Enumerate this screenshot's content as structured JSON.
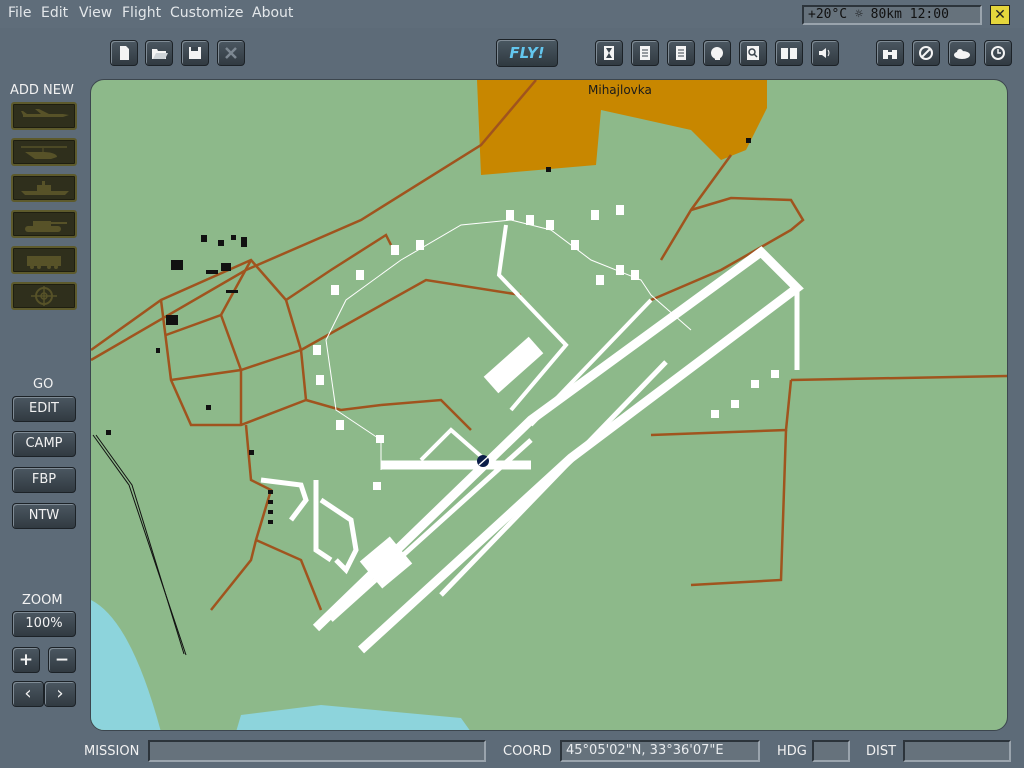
{
  "menu": [
    "File",
    "Edit",
    "View",
    "Flight",
    "Customize",
    "About"
  ],
  "weather": {
    "temperature": "+20°C",
    "visibility": "80km",
    "time": "12:00",
    "icon": "sun-icon"
  },
  "toolbar": {
    "left_icons": [
      "new-file-icon",
      "open-folder-icon",
      "save-icon",
      "close-file-icon"
    ],
    "fly_label": "FLY!",
    "center_icons": [
      "hourglass-icon",
      "clipboard-icon",
      "checklist-icon",
      "pilot-head-icon",
      "magnifier-icon",
      "book-icon",
      "speaker-icon"
    ],
    "right_icons": [
      "binoculars-icon",
      "forbidden-icon",
      "weather-cloud-icon",
      "clock-icon"
    ]
  },
  "add_new": {
    "title": "ADD NEW",
    "items": [
      "aircraft",
      "helicopter",
      "ship",
      "armored-vehicle",
      "ground-vehicle",
      "static-object"
    ]
  },
  "go": {
    "title": "GO",
    "buttons": [
      "EDIT",
      "CAMP",
      "FBP",
      "NTW"
    ]
  },
  "zoom": {
    "title": "ZOOM",
    "level": "100%",
    "plus": "+",
    "minus": "−",
    "left": "‹",
    "right": "›"
  },
  "map": {
    "town_label": "Mihajlovka",
    "colors": {
      "ground": "#8db98a",
      "town": "#c88700",
      "roads": "#a0541e",
      "airfield": "#ffffff",
      "water": "#8dd4dc"
    }
  },
  "status": {
    "mission_label": "MISSION",
    "mission_value": "",
    "coord_label": "COORD",
    "coord_value": "45°05'02\"N, 33°36'07\"E",
    "hdg_label": "HDG",
    "hdg_value": "",
    "dist_label": "DIST",
    "dist_value": ""
  }
}
